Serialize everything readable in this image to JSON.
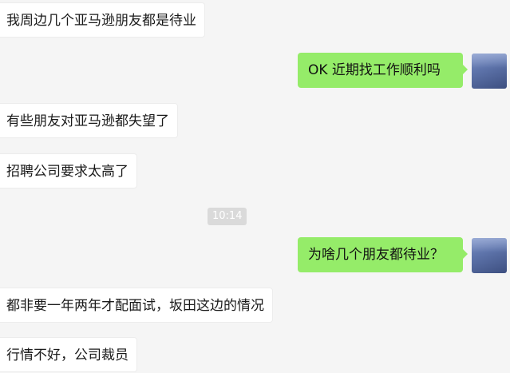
{
  "messages": {
    "m1": {
      "text": "我周边几个亚马逊朋友都是待业"
    },
    "m2": {
      "text": "OK 近期找工作顺利吗"
    },
    "m3": {
      "text": "有些朋友对亚马逊都失望了"
    },
    "m4": {
      "text": "招聘公司要求太高了"
    },
    "m5": {
      "text": "为啥几个朋友都待业？"
    },
    "m6": {
      "text": "都非要一年两年才配面试，坂田这边的情况"
    },
    "m7": {
      "text": "行情不好，公司裁员"
    }
  },
  "timestamp": "10:14",
  "colors": {
    "background": "#f5f5f5",
    "incoming_bubble": "#ffffff",
    "outgoing_bubble": "#95ec69",
    "timestamp_bg": "#dadada"
  },
  "icons": {
    "self_avatar": "user-avatar-icon"
  }
}
